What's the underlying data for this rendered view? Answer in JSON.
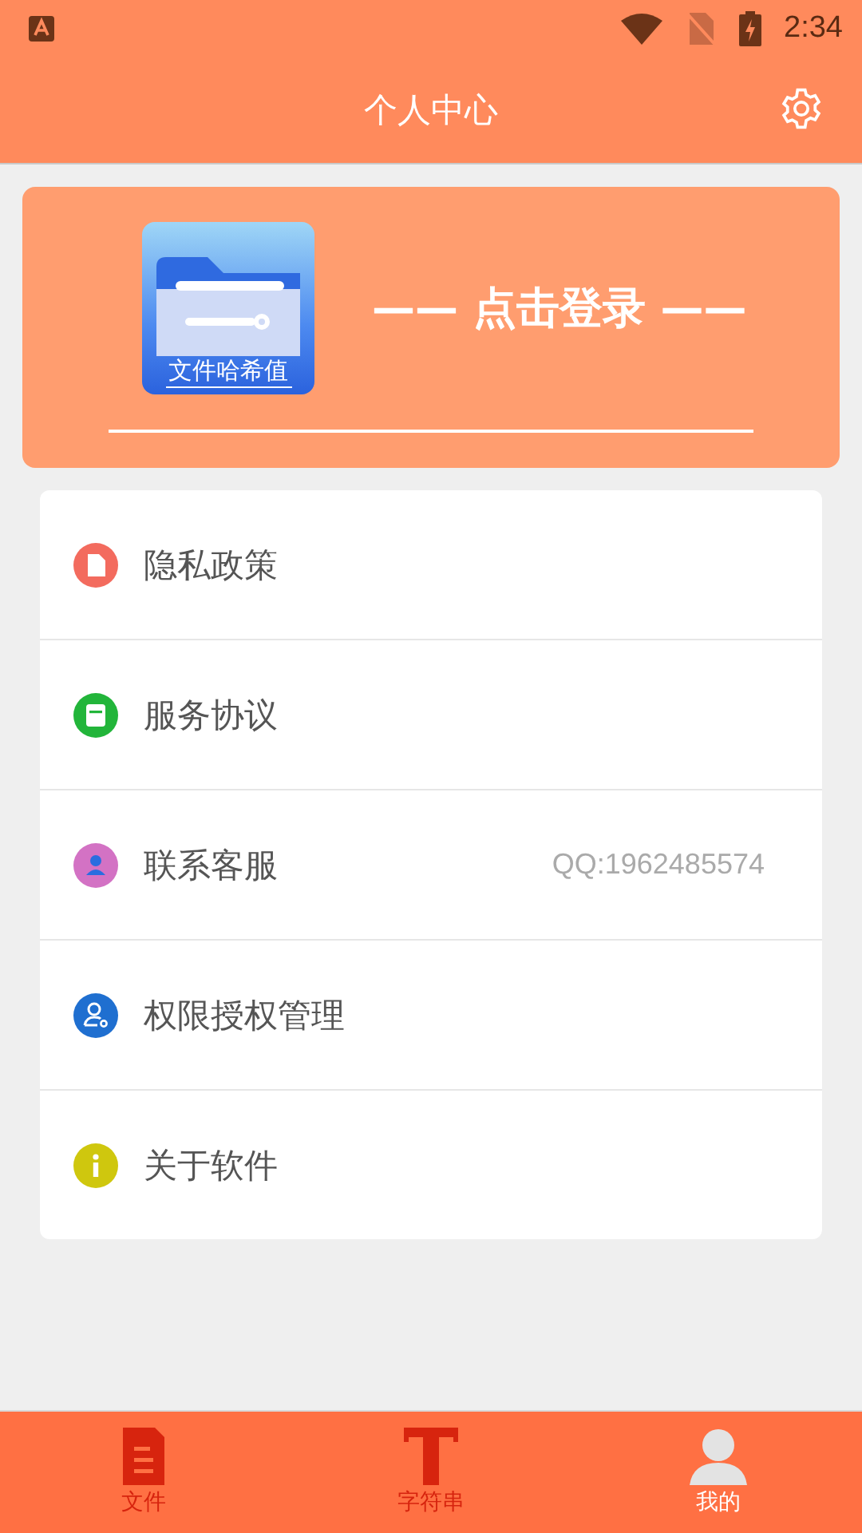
{
  "status_bar": {
    "time": "2:34"
  },
  "app_bar": {
    "title": "个人中心"
  },
  "login_card": {
    "logo_caption": "文件哈希值",
    "prompt": "—— 点击登录 ——"
  },
  "menu": [
    {
      "kind": "doc",
      "color": "#f36b5e",
      "label": "隐私政策"
    },
    {
      "kind": "box",
      "color": "#22b53a",
      "label": "服务协议"
    },
    {
      "kind": "person",
      "color": "#d372c4",
      "label": "联系客服",
      "detail": "QQ:1962485574"
    },
    {
      "kind": "user-key",
      "color": "#1f6fd0",
      "label": "权限授权管理"
    },
    {
      "kind": "info",
      "color": "#cfc70e",
      "label": "关于软件"
    }
  ],
  "bottom_nav": [
    {
      "kind": "file",
      "label": "文件",
      "selected": false
    },
    {
      "kind": "text",
      "label": "字符串",
      "selected": false
    },
    {
      "kind": "user",
      "label": "我的",
      "selected": true
    }
  ]
}
